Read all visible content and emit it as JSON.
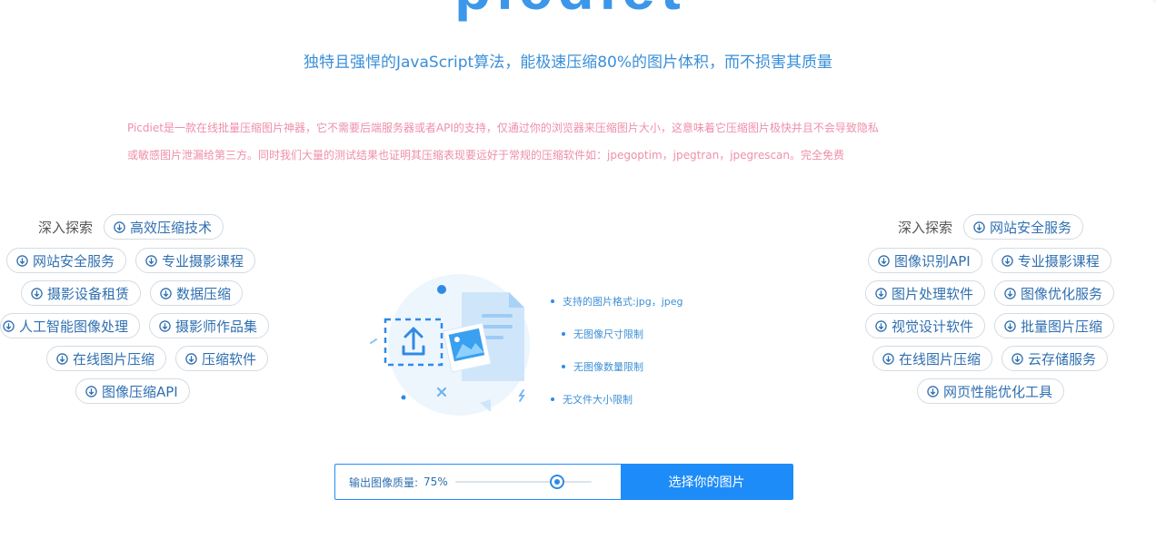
{
  "header": {
    "logo_text": "picdiet",
    "tagline": "独特且强悍的JavaScript算法，能极速压缩80%的图片体积，而不损害其质量"
  },
  "intro": {
    "line1": "Picdiet是一款在线批量压缩图片神器，它不需要后端服务器或者API的支持，仅通过你的浏览器来压缩图片大小，这意味着它压缩图片极快并且不会导致隐私",
    "line2": "或敏感图片泄漏给第三方。同时我们大量的测试结果也证明其压缩表现要远好于常规的压缩软件如：jpegoptim，jpegtran，jpegrescan。完全免费"
  },
  "left_tags": {
    "explore_label": "深入探索",
    "items": [
      "高效压缩技术",
      "网站安全服务",
      "专业摄影课程",
      "摄影设备租赁",
      "数据压缩",
      "人工智能图像处理",
      "摄影师作品集",
      "在线图片压缩",
      "压缩软件",
      "图像压缩API"
    ]
  },
  "right_tags": {
    "explore_label": "深入探索",
    "items": [
      "网站安全服务",
      "图像识别API",
      "专业摄影课程",
      "图片处理软件",
      "图像优化服务",
      "视觉设计软件",
      "批量图片压缩",
      "在线图片压缩",
      "云存储服务",
      "网页性能优化工具"
    ]
  },
  "features": [
    "支持的图片格式:jpg，jpeg",
    "无图像尺寸限制",
    "无图像数量限制",
    "无文件大小限制"
  ],
  "quality": {
    "label": "输出图像质量:",
    "value_text": "75%",
    "value": 0.75
  },
  "choose_button": "选择你的图片",
  "colors": {
    "accent": "#1e8cf8",
    "tagline": "#3a8fd8",
    "intro": "#ef8fa9",
    "pill_text": "#2f6fb0"
  }
}
